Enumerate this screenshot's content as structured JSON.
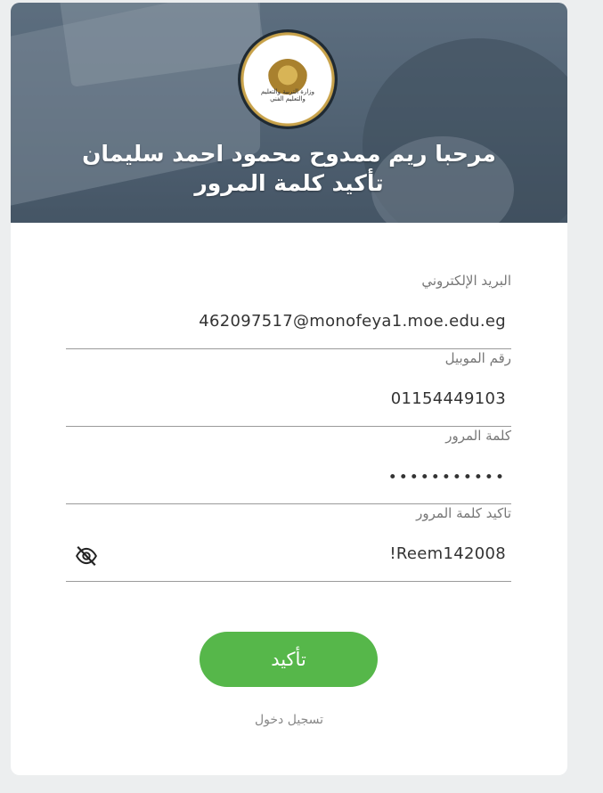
{
  "header": {
    "welcome": "مرحبا ريم ممدوح محمود احمد سليمان",
    "subtitle": "تأكيد كلمة المرور",
    "logo_ring_text": "MINISTRY OF EDUCATION AND TECHNICAL EDUCATION",
    "logo_arabic_text": "وزارة التربية والتعليم والتعليم الفني"
  },
  "form": {
    "email": {
      "label": "البريد الإلكتروني",
      "value": "462097517@monofeya1.moe.edu.eg"
    },
    "mobile": {
      "label": "رقم الموبيل",
      "value": "01154449103"
    },
    "password": {
      "label": "كلمة المرور",
      "value": "•••••••••••"
    },
    "confirm": {
      "label": "تاكيد كلمة المرور",
      "value": "!Reem142008",
      "toggle_icon": "eye-off-icon"
    }
  },
  "actions": {
    "submit_label": "تأكيد",
    "login_label": "تسجيل دخول"
  },
  "colors": {
    "accent": "#56b74a",
    "background": "#eceeef"
  }
}
